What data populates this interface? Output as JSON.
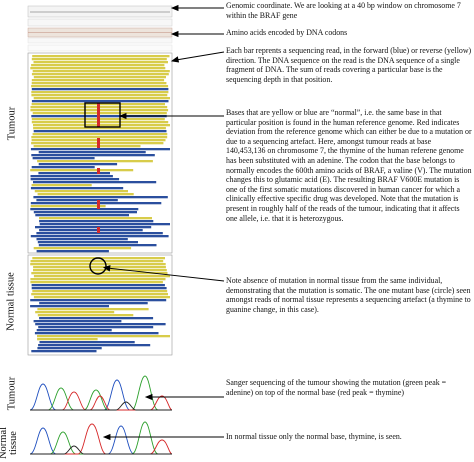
{
  "annotations": {
    "genomic": "Genomic coordinate. We are looking at a 40 bp window on chromosome 7 within the BRAF gene",
    "amino_acids": "Amino acids encoded by DNA codons",
    "reads": "Each bar reprents a sequencing read, in the forward (blue) or reverse (yellow) direction. The DNA sequence on the read is the DNA sequence of a single fragment of DNA. The sum of reads covering a particular base is the sequencing depth in that position.",
    "mutation": "Bases that are yellow or blue are “normal”, i.e. the same base in that particular position is found in the human reference genome. Red indicates deviation from the reference genome which can either be due to a mutation or due to a sequencing artefact. Here, amongst tumour reads at base 140,453,136 on chromosome 7, the thymine of the human referene genome has been substituted with an adenine. The codon that the base belongs to normally encodes the 600th amino acids of BRAF, a valine (V). The mutation changes this to glutamic acid (E). The resulting BRAF V600E mutation is one of the first somatic mutations discovered in human cancer for which a clinically effective specific drug was developed. Note that the mutation is present in roughly half of the reads of the tumour, indicating that it affects one allele, i.e. that it is heterozygous.",
    "normal_tissue": "Note absence of mutation in normal tissue from the same individual, demonstrating that the mutation is somatic. The one mutant base (circle) seen amongst reads of normal tissue represents a sequencing artefact (a thymine to guanine change, in this case).",
    "sanger_tumour": "Sanger sequencing of the tumour showing the mutation (green peak = adenine) on top of the normal base (red peak = thymine)",
    "sanger_normal": "In normal tissue only the normal base, thymine, is seen."
  },
  "side_labels": {
    "tumour": "Tumour",
    "normal_tissue": "Normal tissue",
    "sanger_tumour": "Tumour",
    "sanger_normal": "Normal tissue"
  },
  "colors": {
    "forward_read": "#2b4f9e",
    "reverse_read": "#d8cc4a",
    "mutation": "#d42a2a",
    "sanger_adenine": "#2ca02c",
    "sanger_thymine": "#d62728",
    "sanger_cytosine": "#1f4fbf",
    "sanger_guanine": "#222222"
  }
}
